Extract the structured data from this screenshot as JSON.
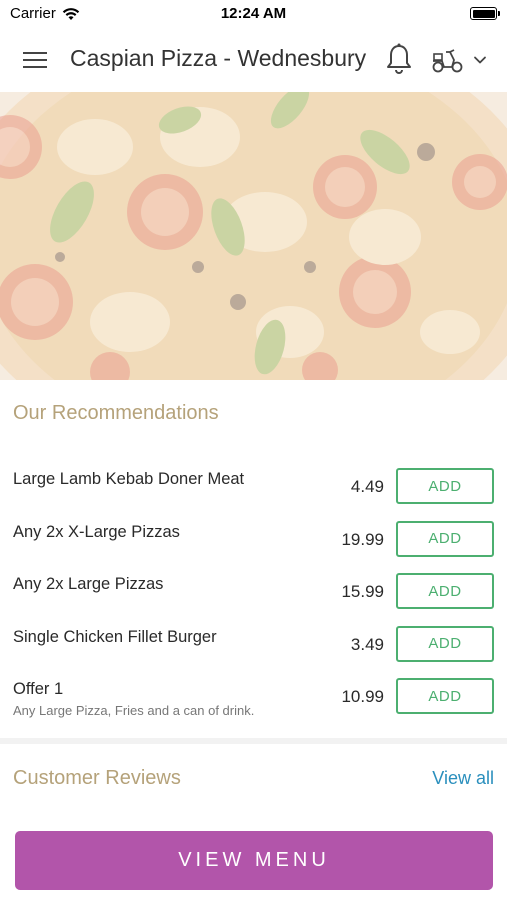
{
  "status_bar": {
    "carrier": "Carrier",
    "time": "12:24 AM",
    "wifi_icon": "wifi-icon",
    "battery_icon": "battery-icon"
  },
  "header": {
    "title": "Caspian Pizza - Wednesbury",
    "menu_icon": "hamburger-menu-icon",
    "bell_icon": "bell-icon",
    "delivery_icon": "scooter-icon",
    "dropdown_icon": "chevron-down-icon"
  },
  "hero": {
    "image": "pizza-hero-image"
  },
  "recommendations": {
    "title": "Our Recommendations",
    "items": [
      {
        "name": "Large Lamb Kebab Doner Meat",
        "description": "",
        "price": "4.49",
        "add_label": "ADD"
      },
      {
        "name": "Any 2x X-Large Pizzas",
        "description": "",
        "price": "19.99",
        "add_label": "ADD"
      },
      {
        "name": "Any 2x Large Pizzas",
        "description": "",
        "price": "15.99",
        "add_label": "ADD"
      },
      {
        "name": "Single Chicken Fillet Burger",
        "description": "",
        "price": "3.49",
        "add_label": "ADD"
      },
      {
        "name": "Offer 1",
        "description": "Any Large Pizza, Fries and a can of drink.",
        "price": "10.99",
        "add_label": "ADD"
      }
    ]
  },
  "reviews": {
    "title": "Customer Reviews",
    "view_all": "View all"
  },
  "view_menu_button": "VIEW MENU",
  "colors": {
    "accent_gold": "#b5a27a",
    "add_green": "#4caf70",
    "link_blue": "#2a8fbd",
    "button_purple": "#b255aa"
  }
}
